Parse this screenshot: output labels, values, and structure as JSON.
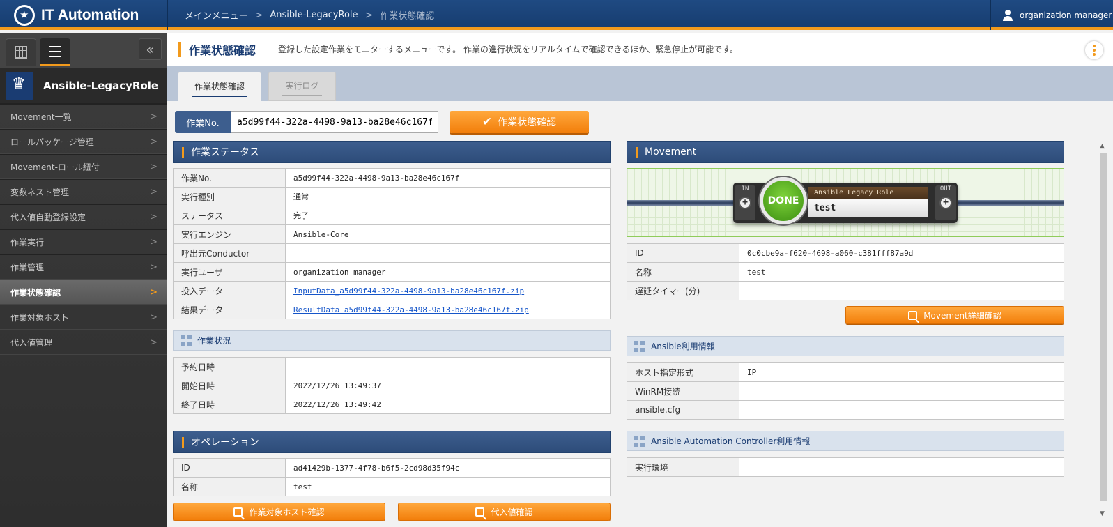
{
  "app": {
    "title": "IT Automation"
  },
  "breadcrumb": [
    "メインメニュー",
    "Ansible-LegacyRole",
    "作業状態確認"
  ],
  "user": {
    "name": "organization manager"
  },
  "sidebar": {
    "menu_title": "Ansible-LegacyRole",
    "items": [
      {
        "label": "Movement一覧",
        "active": false
      },
      {
        "label": "ロールパッケージ管理",
        "active": false
      },
      {
        "label": "Movement-ロール紐付",
        "active": false
      },
      {
        "label": "変数ネスト管理",
        "active": false
      },
      {
        "label": "代入値自動登録設定",
        "active": false
      },
      {
        "label": "作業実行",
        "active": false
      },
      {
        "label": "作業管理",
        "active": false
      },
      {
        "label": "作業状態確認",
        "active": true
      },
      {
        "label": "作業対象ホスト",
        "active": false
      },
      {
        "label": "代入値管理",
        "active": false
      }
    ]
  },
  "page": {
    "title": "作業状態確認",
    "description": "登録した設定作業をモニターするメニューです。 作業の進行状況をリアルタイムで確認できるほか、緊急停止が可能です。"
  },
  "tabs": [
    "作業状態確認",
    "実行ログ"
  ],
  "work_no": {
    "label": "作業No.",
    "value": "a5d99f44-322a-4498-9a13-ba28e46c167f"
  },
  "check_button": "作業状態確認",
  "work_status": {
    "title": "作業ステータス",
    "rows": [
      {
        "key": "作業No.",
        "value": "a5d99f44-322a-4498-9a13-ba28e46c167f"
      },
      {
        "key": "実行種別",
        "value": "通常"
      },
      {
        "key": "ステータス",
        "value": "完了"
      },
      {
        "key": "実行エンジン",
        "value": "Ansible-Core"
      },
      {
        "key": "呼出元Conductor",
        "value": ""
      },
      {
        "key": "実行ユーザ",
        "value": "organization manager"
      },
      {
        "key": "投入データ",
        "value": "InputData_a5d99f44-322a-4498-9a13-ba28e46c167f.zip"
      },
      {
        "key": "結果データ",
        "value": "ResultData_a5d99f44-322a-4498-9a13-ba28e46c167f.zip"
      }
    ]
  },
  "work_progress": {
    "title": "作業状況",
    "rows": [
      {
        "key": "予約日時",
        "value": ""
      },
      {
        "key": "開始日時",
        "value": "2022/12/26 13:49:37"
      },
      {
        "key": "終了日時",
        "value": "2022/12/26 13:49:42"
      }
    ]
  },
  "operation": {
    "title": "オペレーション",
    "rows": [
      {
        "key": "ID",
        "value": "ad41429b-1377-4f78-b6f5-2cd98d35f94c"
      },
      {
        "key": "名称",
        "value": "test"
      }
    ],
    "host_button": "作業対象ホスト確認",
    "value_button": "代入値確認"
  },
  "movement": {
    "title": "Movement",
    "node": {
      "status": "DONE",
      "in": "IN",
      "out": "OUT",
      "type": "Ansible Legacy Role",
      "name": "test"
    },
    "rows": [
      {
        "key": "ID",
        "value": "0c0cbe9a-f620-4698-a060-c381fff87a9d"
      },
      {
        "key": "名称",
        "value": "test"
      },
      {
        "key": "遅延タイマー(分)",
        "value": ""
      }
    ],
    "detail_button": "Movement詳細確認"
  },
  "ansible_info": {
    "title": "Ansible利用情報",
    "rows": [
      {
        "key": "ホスト指定形式",
        "value": "IP"
      },
      {
        "key": "WinRM接続",
        "value": ""
      },
      {
        "key": "ansible.cfg",
        "value": ""
      }
    ]
  },
  "aac_info": {
    "title": "Ansible Automation Controller利用情報",
    "rows": [
      {
        "key": "実行環境",
        "value": ""
      }
    ]
  },
  "colors": {
    "accent": "#f29a1c",
    "header": "#1a3c72",
    "done": "#4caf1a"
  },
  "icons": [
    "grid-icon",
    "list-icon",
    "collapse-icon",
    "user-icon",
    "check-icon",
    "magnifier-icon",
    "kebab-icon",
    "plus-icon"
  ]
}
